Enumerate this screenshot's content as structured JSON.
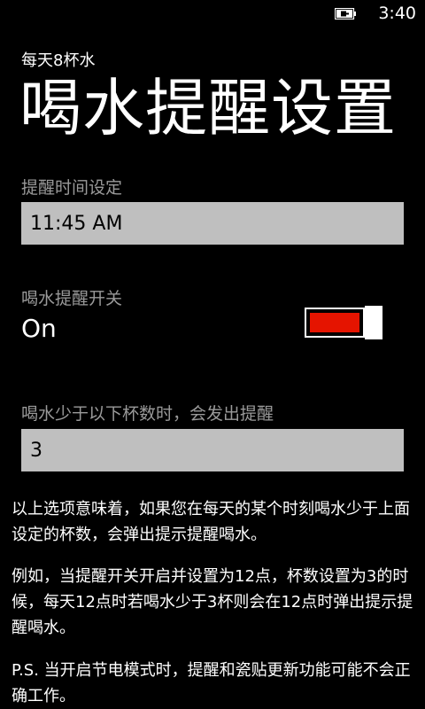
{
  "status_bar": {
    "time": "3:40",
    "battery_icon": "battery-charging-icon"
  },
  "app": {
    "app_title": "每天8杯水",
    "page_title": "喝水提醒设置"
  },
  "reminder_time": {
    "label": "提醒时间设定",
    "value": "11:45 AM"
  },
  "reminder_toggle": {
    "label": "喝水提醒开关",
    "state_text": "On",
    "on": true,
    "accent_color": "#e51400"
  },
  "cup_threshold": {
    "label": "喝水少于以下杯数时，会发出提醒",
    "value": "3"
  },
  "descriptions": [
    "以上选项意味着，如果您在每天的某个时刻喝水少于上面设定的杯数，会弹出提示提醒喝水。",
    "例如，当提醒开关开启并设置为12点，杯数设置为3的时候，每天12点时若喝水少于3杯则会在12点时弹出提示提醒喝水。",
    "P.S. 当开启节电模式时，提醒和瓷贴更新功能可能不会正确工作。"
  ]
}
